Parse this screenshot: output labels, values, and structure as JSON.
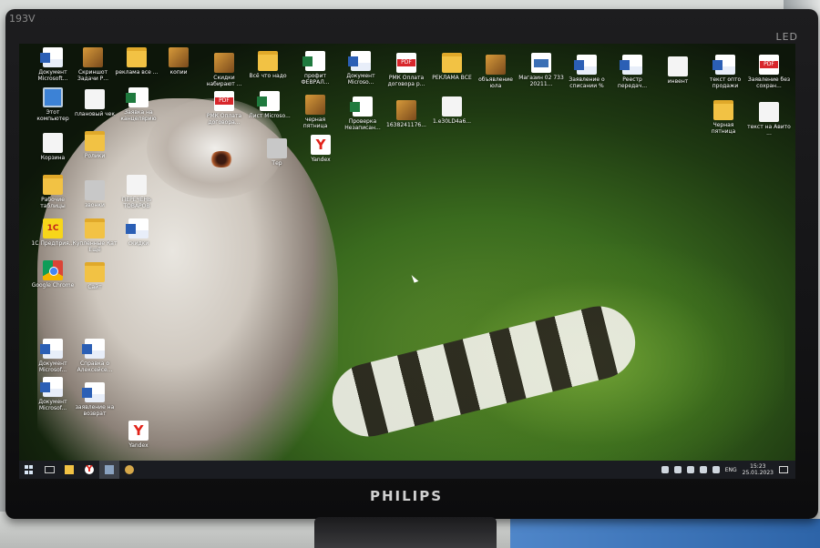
{
  "monitor": {
    "model": "193V",
    "led": "LED",
    "brand": "PHILIPS"
  },
  "desktop": {
    "icons": [
      {
        "label": "Документ Microsoft...",
        "icon": "word-icon"
      },
      {
        "label": "Скриншот Задачи Р...",
        "icon": "image-icon"
      },
      {
        "label": "реклама все ...",
        "icon": "folder-icon"
      },
      {
        "label": "копии",
        "icon": "image-icon"
      },
      {
        "label": "Скидки набирают ...",
        "icon": "image-icon"
      },
      {
        "label": "Всё что надо",
        "icon": "folder-icon"
      },
      {
        "label": "профит ФЕВРАЛ...",
        "icon": "excel-icon"
      },
      {
        "label": "Документ Microso...",
        "icon": "word-icon"
      },
      {
        "label": "РМК Оплата договора р...",
        "icon": "pdf-icon"
      },
      {
        "label": "РЕКЛАМА ВСЕ",
        "icon": "folder-icon"
      },
      {
        "label": "объявление юла",
        "icon": "image-icon"
      },
      {
        "label": "Магазин 02 733 20211...",
        "icon": "video-icon"
      },
      {
        "label": "Заявление о списании %",
        "icon": "word-icon"
      },
      {
        "label": "Реестр передач...",
        "icon": "word-icon"
      },
      {
        "label": "инвент",
        "icon": "blank-icon"
      },
      {
        "label": "текст опто продажи",
        "icon": "word-icon"
      },
      {
        "label": "Заявление без сохран...",
        "icon": "pdf-icon"
      },
      {
        "label": "Этот компьютер",
        "icon": "computer-icon"
      },
      {
        "label": "плановый чек",
        "icon": "blank-icon"
      },
      {
        "label": "Заявка на канцелярию",
        "icon": "excel-icon"
      },
      {
        "label": "РМК Оплата договора...",
        "icon": "pdf-icon"
      },
      {
        "label": "Лист Microso...",
        "icon": "excel-icon"
      },
      {
        "label": "черная пятница",
        "icon": "image-icon"
      },
      {
        "label": "Проверка Незаписан...",
        "icon": "excel-icon"
      },
      {
        "label": "1638241176...",
        "icon": "image-icon"
      },
      {
        "label": "1.e30LD4a6...",
        "icon": "blank-icon"
      },
      {
        "label": "Черная пятница",
        "icon": "folder-icon"
      },
      {
        "label": "текст на Авито ...",
        "icon": "blank-icon"
      },
      {
        "label": "Корзина",
        "icon": "recycle-bin-icon"
      },
      {
        "label": "Ролики",
        "icon": "folder-icon"
      },
      {
        "label": "Тер",
        "icon": "app-icon"
      },
      {
        "label": "Yandex",
        "icon": "yandex-icon"
      },
      {
        "label": "Рабочие таблицы",
        "icon": "folder-icon"
      },
      {
        "label": "звонки",
        "icon": "app-icon"
      },
      {
        "label": "ПЕРЕЧЕНЬ ТОВАРОВ",
        "icon": "blank-icon"
      },
      {
        "label": "1С Предприя...",
        "icon": "1c-icon"
      },
      {
        "label": "Купленные Кат Ещё",
        "icon": "folder-icon"
      },
      {
        "label": "скидки",
        "icon": "word-icon"
      },
      {
        "label": "Google Chrome",
        "icon": "chrome-icon"
      },
      {
        "label": "Сайт",
        "icon": "folder-icon"
      },
      {
        "label": "Документ Microsof...",
        "icon": "word-icon"
      },
      {
        "label": "Справка о Алексейсе...",
        "icon": "word-icon"
      },
      {
        "label": "Документ Microsof...",
        "icon": "word-icon"
      },
      {
        "label": "заявление на возврат",
        "icon": "word-icon"
      },
      {
        "label": "Yandex",
        "icon": "yandex-icon"
      }
    ]
  },
  "taskbar": {
    "items": [
      {
        "name": "start-button",
        "active": false
      },
      {
        "name": "task-view-button",
        "active": false
      },
      {
        "name": "explorer-taskbar-button",
        "active": false
      },
      {
        "name": "yandex-taskbar-button",
        "active": false
      },
      {
        "name": "app-taskbar-button",
        "active": true
      },
      {
        "name": "mail-taskbar-button",
        "active": false
      }
    ],
    "language": "ENG",
    "time": "15:23",
    "date": "25.01.2023"
  }
}
